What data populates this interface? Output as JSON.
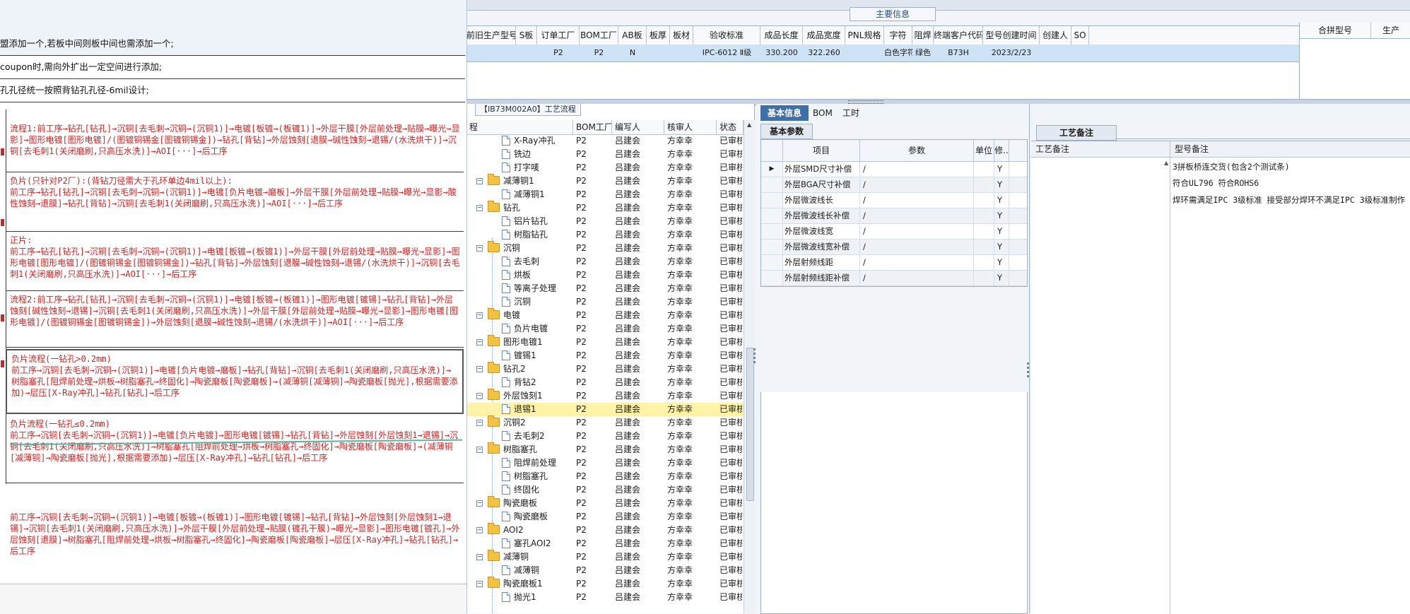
{
  "main_info_title": "主要信息",
  "info_headers": [
    "前旧生产型号",
    "S板",
    "订单工厂",
    "BOM工厂",
    "AB板",
    "板厚",
    "板材",
    "验收标准",
    "成品长度",
    "成品宽度",
    "PNL规格",
    "字符",
    "阻焊",
    "终端客户代码",
    "型号创建时间",
    "创建人",
    "SO"
  ],
  "info_row": [
    "",
    "",
    "P2",
    "P2",
    "N",
    "",
    "",
    "IPC-6012 Ⅱ级",
    "330.200",
    "322.260",
    "",
    "白色字符",
    "绿色",
    "B73H",
    "2023/2/23",
    "",
    ""
  ],
  "right_headers": [
    "合拼型号",
    "生产"
  ],
  "doc": {
    "lines": [
      "盟添加一个,若板中间则板中间也需添加一个;",
      "coupon时,需向外扩出一定空间进行添加;",
      "孔孔径统一按照背钻孔孔径-6mil设计;"
    ],
    "flows": [
      "流程1:前工序→钻孔[钻孔]→沉铜[去毛刺→沉铜→(沉铜1)]→电镀[板镀→(板镀1)]→外层干膜[外层前处理→贴膜→曝光→显影]→图形电镀[图形电镀]/(图镀铜锡金[图镀铜锡金])→钻孔[背钻]→外层蚀刻[退膜→碱性蚀刻→退锡/(水洗烘干)]→沉铜[去毛刺1(关闭磨刷,只高压水洗)]→AOI[···]→后工序",
      "负片(只针对P2厂):(背钻刀径需大于孔环单边4mil以上):\n前工序→钻孔[钻孔]→沉铜[去毛刺→沉铜→(沉铜1)]→电镀[负片电镀→磨板]→外层干膜[外层前处理→贴膜→曝光→显影→酸性蚀刻→退膜]→钻孔[背钻]→沉铜[去毛刺1(关闭磨刷,只高压水洗)]→AOI[···]→后工序",
      "正片:\n前工序→钻孔[钻孔]→沉铜[去毛刺→沉铜→(沉铜1)]→电镀[板镀→(板镀1)]→外层干膜[外层前处理→贴膜→曝光→显影]→图形电镀[图形电镀]/(图镀铜锡金[图镀铜锡金])→钻孔[背钻]→外层蚀刻[退膜→碱性蚀刻→退锡/(水洗烘干)]→沉铜[去毛刺1(关闭磨刷,只高压水洗)]→AOI[···]→后工序",
      "流程2:前工序→钻孔[钻孔]→沉铜[去毛刺→沉铜→(沉铜1)]→电镀[板镀→(板镀1)]→图形电镀[镀锡]→钻孔[背钻]→外层蚀刻[碱性蚀刻→退锡]→沉铜[去毛刺1(关闭磨刷,只高压水洗)]→外层干膜[外层前处理→贴膜→曝光→显影]→图形电镀[图形电镀]/(图镀铜锡金[图镀铜锡金])→外层蚀刻[退膜→碱性蚀刻→退锡/(水洗烘干)]→AOI[···]→后工序",
      "负片流程(一钻孔>0.2mm)\n前工序→沉铜[去毛刺→沉铜→(沉铜1)]→电镀[负片电镀→磨板]→钻孔[背钻]→沉铜[去毛刺1(关闭磨刷,只高压水洗)]→树脂塞孔[阻焊前处理→烘板→树脂塞孔→终固化]→陶瓷磨板[陶瓷磨板]→(减薄铜[减薄铜]→陶瓷磨板[抛光],根据需要添加)→层压[X-Ray冲孔]→钻孔[钻孔]→后工序",
      "负片流程(一钻孔≤0.2mm)\n前工序→沉铜[去毛刺→沉铜→(沉铜1)]→电镀[负片电镀]→图形电镀[镀锡]→钻孔[背钻]→外层蚀刻[外层蚀刻1→退锡]→沉铜[去毛刺1(关闭磨刷,只高压水洗)]→树脂塞孔[阻焊前处理→烘板→树脂塞孔→终固化]→陶瓷磨板[陶瓷磨板]→(减薄铜[减薄铜]→陶瓷磨板[抛光],根据需要添加)→层压[X-Ray冲孔]→钻孔[钻孔]→后工序",
      "前工序→沉铜[去毛刺→沉铜→(沉铜1)]→电镀[板镀→(板镀1)]→图形电镀[镀锡]→钻孔[背钻]→外层蚀刻[外层蚀刻1→退锡]→沉铜[去毛刺1(关闭磨刷,只高压水洗)]→外层干膜[外层前处理→贴膜(镀孔干膜)→曝光→显影]→图形电镀[镀孔]→外层蚀刻[退膜]→树脂塞孔[阻焊前处理→烘板→树脂塞孔→终固化]→陶瓷磨板[陶瓷磨板]→层压[X-Ray冲孔]→钻孔[钻孔]→后工序"
    ]
  },
  "tree": {
    "title": "【IB73M002A0】工艺流程",
    "headers": [
      "程",
      "BOM工厂",
      "编写人",
      "核审人",
      "状态"
    ],
    "rows": [
      {
        "name": "X-Ray冲孔",
        "type": "file",
        "level": 2,
        "bom": "P2",
        "author": "吕建会",
        "reviewer": "方幸幸",
        "status": "已审核"
      },
      {
        "name": "铣边",
        "type": "file",
        "level": 2,
        "bom": "P2",
        "author": "吕建会",
        "reviewer": "方幸幸",
        "status": "已审核"
      },
      {
        "name": "打字唛",
        "type": "file",
        "level": 2,
        "bom": "P2",
        "author": "吕建会",
        "reviewer": "方幸幸",
        "status": "已审核"
      },
      {
        "name": "减薄铜1",
        "type": "folder",
        "level": 1,
        "bom": "P2",
        "author": "吕建会",
        "reviewer": "方幸幸",
        "status": "已审核"
      },
      {
        "name": "减薄铜1",
        "type": "file",
        "level": 2,
        "bom": "P2",
        "author": "吕建会",
        "reviewer": "方幸幸",
        "status": "已审核"
      },
      {
        "name": "钻孔",
        "type": "folder",
        "level": 1,
        "bom": "P2",
        "author": "吕建会",
        "reviewer": "方幸幸",
        "status": "已审核"
      },
      {
        "name": "铝片钻孔",
        "type": "file",
        "level": 2,
        "bom": "P2",
        "author": "吕建会",
        "reviewer": "方幸幸",
        "status": "已审核"
      },
      {
        "name": "树脂钻孔",
        "type": "file",
        "level": 2,
        "bom": "P2",
        "author": "吕建会",
        "reviewer": "方幸幸",
        "status": "已审核"
      },
      {
        "name": "沉铜",
        "type": "folder",
        "level": 1,
        "bom": "P2",
        "author": "吕建会",
        "reviewer": "方幸幸",
        "status": "已审核"
      },
      {
        "name": "去毛刺",
        "type": "file",
        "level": 2,
        "bom": "P2",
        "author": "吕建会",
        "reviewer": "方幸幸",
        "status": "已审核"
      },
      {
        "name": "烘板",
        "type": "file",
        "level": 2,
        "bom": "P2",
        "author": "吕建会",
        "reviewer": "方幸幸",
        "status": "已审核"
      },
      {
        "name": "等离子处理",
        "type": "file",
        "level": 2,
        "bom": "P2",
        "author": "吕建会",
        "reviewer": "方幸幸",
        "status": "已审核"
      },
      {
        "name": "沉铜",
        "type": "file",
        "level": 2,
        "bom": "P2",
        "author": "吕建会",
        "reviewer": "方幸幸",
        "status": "已审核"
      },
      {
        "name": "电镀",
        "type": "folder",
        "level": 1,
        "bom": "P2",
        "author": "吕建会",
        "reviewer": "方幸幸",
        "status": "已审核"
      },
      {
        "name": "负片电镀",
        "type": "file",
        "level": 2,
        "bom": "P2",
        "author": "吕建会",
        "reviewer": "方幸幸",
        "status": "已审核"
      },
      {
        "name": "图形电镀1",
        "type": "folder",
        "level": 1,
        "bom": "P2",
        "author": "吕建会",
        "reviewer": "方幸幸",
        "status": "已审核"
      },
      {
        "name": "镀锡1",
        "type": "file",
        "level": 2,
        "bom": "P2",
        "author": "吕建会",
        "reviewer": "方幸幸",
        "status": "已审核"
      },
      {
        "name": "钻孔2",
        "type": "folder",
        "level": 1,
        "bom": "P2",
        "author": "吕建会",
        "reviewer": "方幸幸",
        "status": "已审核"
      },
      {
        "name": "背钻2",
        "type": "file",
        "level": 2,
        "bom": "P2",
        "author": "吕建会",
        "reviewer": "方幸幸",
        "status": "已审核"
      },
      {
        "name": "外层蚀刻1",
        "type": "folder",
        "level": 1,
        "bom": "P2",
        "author": "吕建会",
        "reviewer": "方幸幸",
        "status": "已审核"
      },
      {
        "name": "退锡1",
        "type": "file",
        "level": 2,
        "bom": "P2",
        "author": "吕建会",
        "reviewer": "方幸幸",
        "status": "已审核",
        "selected": true
      },
      {
        "name": "沉铜2",
        "type": "folder",
        "level": 1,
        "bom": "P2",
        "author": "吕建会",
        "reviewer": "方幸幸",
        "status": "已审核"
      },
      {
        "name": "去毛刺2",
        "type": "file",
        "level": 2,
        "bom": "P2",
        "author": "吕建会",
        "reviewer": "方幸幸",
        "status": "已审核"
      },
      {
        "name": "树脂塞孔",
        "type": "folder",
        "level": 1,
        "bom": "P2",
        "author": "吕建会",
        "reviewer": "方幸幸",
        "status": "已审核"
      },
      {
        "name": "阻焊前处理",
        "type": "file",
        "level": 2,
        "bom": "P2",
        "author": "吕建会",
        "reviewer": "方幸幸",
        "status": "已审核"
      },
      {
        "name": "树脂塞孔",
        "type": "file",
        "level": 2,
        "bom": "P2",
        "author": "吕建会",
        "reviewer": "方幸幸",
        "status": "已审核"
      },
      {
        "name": "终固化",
        "type": "file",
        "level": 2,
        "bom": "P2",
        "author": "吕建会",
        "reviewer": "方幸幸",
        "status": "已审核"
      },
      {
        "name": "陶瓷磨板",
        "type": "folder",
        "level": 1,
        "bom": "P2",
        "author": "吕建会",
        "reviewer": "方幸幸",
        "status": "已审核"
      },
      {
        "name": "陶瓷磨板",
        "type": "file",
        "level": 2,
        "bom": "P2",
        "author": "吕建会",
        "reviewer": "方幸幸",
        "status": "已审核"
      },
      {
        "name": "AOI2",
        "type": "folder",
        "level": 1,
        "bom": "P2",
        "author": "吕建会",
        "reviewer": "方幸幸",
        "status": "已审核"
      },
      {
        "name": "塞孔AOI2",
        "type": "file",
        "level": 2,
        "bom": "P2",
        "author": "吕建会",
        "reviewer": "方幸幸",
        "status": "已审核"
      },
      {
        "name": "减薄铜",
        "type": "folder",
        "level": 1,
        "bom": "P2",
        "author": "吕建会",
        "reviewer": "方幸幸",
        "status": "已审核"
      },
      {
        "name": "减薄铜",
        "type": "file",
        "level": 2,
        "bom": "P2",
        "author": "吕建会",
        "reviewer": "方幸幸",
        "status": "已审核"
      },
      {
        "name": "陶瓷磨板1",
        "type": "folder",
        "level": 1,
        "bom": "P2",
        "author": "吕建会",
        "reviewer": "方幸幸",
        "status": "已审核"
      },
      {
        "name": "抛光1",
        "type": "file",
        "level": 2,
        "bom": "P2",
        "author": "吕建会",
        "reviewer": "方幸幸",
        "status": "已审核"
      }
    ]
  },
  "tabs": [
    "基本信息",
    "BOM",
    "工时"
  ],
  "basic_params_title": "基本参数",
  "param_headers": [
    "项目",
    "参数",
    "单位",
    "修.."
  ],
  "params": [
    {
      "item": "外层SMD尺寸补偿",
      "value": "/",
      "unit": "",
      "flag": "Y"
    },
    {
      "item": "外层BGA尺寸补偿",
      "value": "/",
      "unit": "",
      "flag": "Y"
    },
    {
      "item": "外层微波线长",
      "value": "/",
      "unit": "",
      "flag": "Y"
    },
    {
      "item": "外层微波线长补偿",
      "value": "/",
      "unit": "",
      "flag": "Y"
    },
    {
      "item": "外层微波线宽",
      "value": "/",
      "unit": "",
      "flag": "Y"
    },
    {
      "item": "外层微波线宽补偿",
      "value": "/",
      "unit": "",
      "flag": "Y"
    },
    {
      "item": "外层射频线距",
      "value": "/",
      "unit": "",
      "flag": "Y"
    },
    {
      "item": "外层射频线距补偿",
      "value": "/",
      "unit": "",
      "flag": "Y"
    }
  ],
  "notes": {
    "title": "工艺备注",
    "headers": [
      "工艺备注",
      "型号备注"
    ],
    "lines": [
      "3拼板桥连交货(包含2个测试条)",
      "符合UL796     符合ROHS6",
      "焊环需满足IPC 3级标准   接受部分焊环不满足IPC 3级标准制作"
    ]
  }
}
